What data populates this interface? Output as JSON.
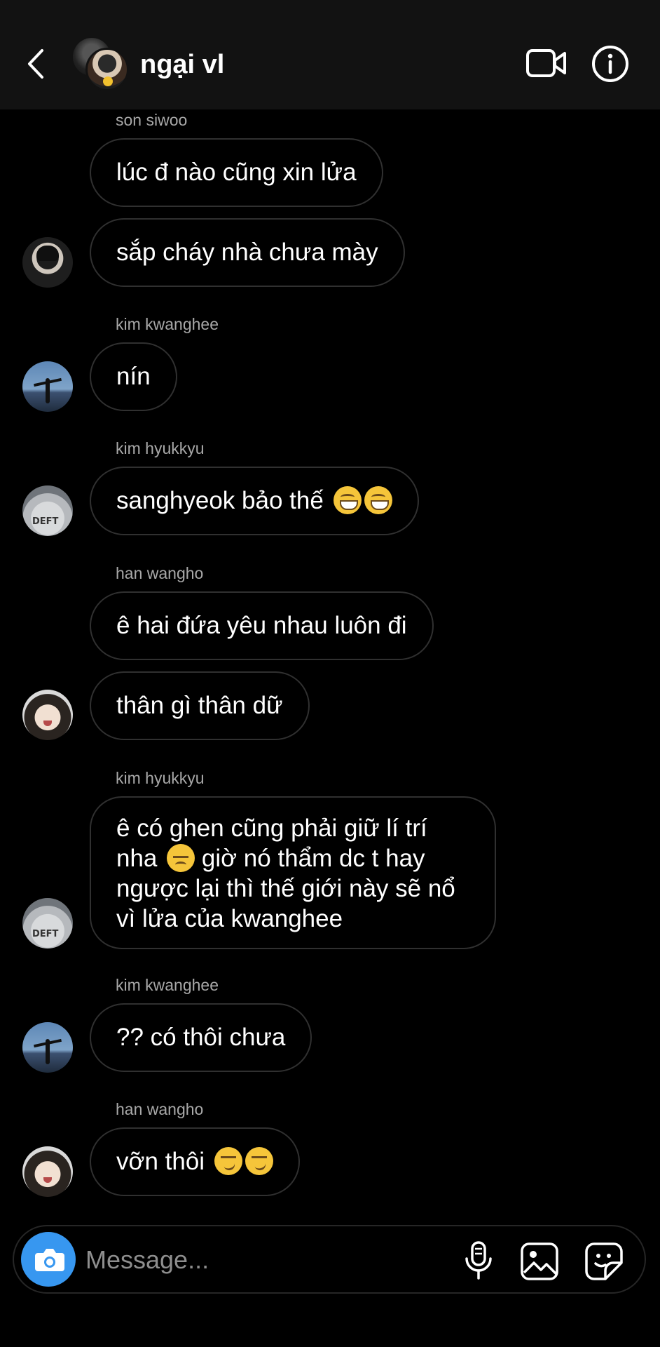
{
  "header": {
    "title": "ngại vl",
    "back_icon": "chevron-left-icon",
    "video_icon": "video-call-icon",
    "info_icon": "info-icon"
  },
  "messages": [
    {
      "sender": "son siwoo",
      "text": "lúc đ nào cũng xin lửa"
    },
    {
      "sender": "",
      "text": "sắp cháy nhà chưa mày"
    },
    {
      "sender": "kim kwanghee",
      "text": "nín"
    },
    {
      "sender": "kim hyukkyu",
      "text": "sanghyeok bảo thế",
      "emoji": [
        "grinning-emoji",
        "grinning-emoji"
      ]
    },
    {
      "sender": "han wangho",
      "text": "ê hai đứa yêu nhau luôn đi"
    },
    {
      "sender": "",
      "text": "thân gì thân dữ"
    },
    {
      "sender": "kim hyukkyu",
      "text_a": "ê có ghen cũng phải giữ lí trí nha",
      "emoji": [
        "disappointed-emoji"
      ],
      "text_b": "giờ nó thẩm dc t hay ngược lại thì thế giới này sẽ nổ vì lửa của kwanghee"
    },
    {
      "sender": "kim kwanghee",
      "text": "?? có thôi chưa"
    },
    {
      "sender": "han wangho",
      "text": "vỡn thôi",
      "emoji": [
        "smirk-emoji",
        "smirk-emoji"
      ]
    }
  ],
  "avatar_text": {
    "hyukkyu": "DEFT"
  },
  "composer": {
    "placeholder": "Message...",
    "camera_icon": "camera-icon",
    "mic_icon": "microphone-icon",
    "gallery_icon": "gallery-icon",
    "sticker_icon": "sticker-icon"
  },
  "colors": {
    "background": "#000000",
    "header_bg": "#121212",
    "bubble_border": "#303030",
    "sender_text": "#a8a8a8",
    "camera_button": "#3797f0"
  }
}
